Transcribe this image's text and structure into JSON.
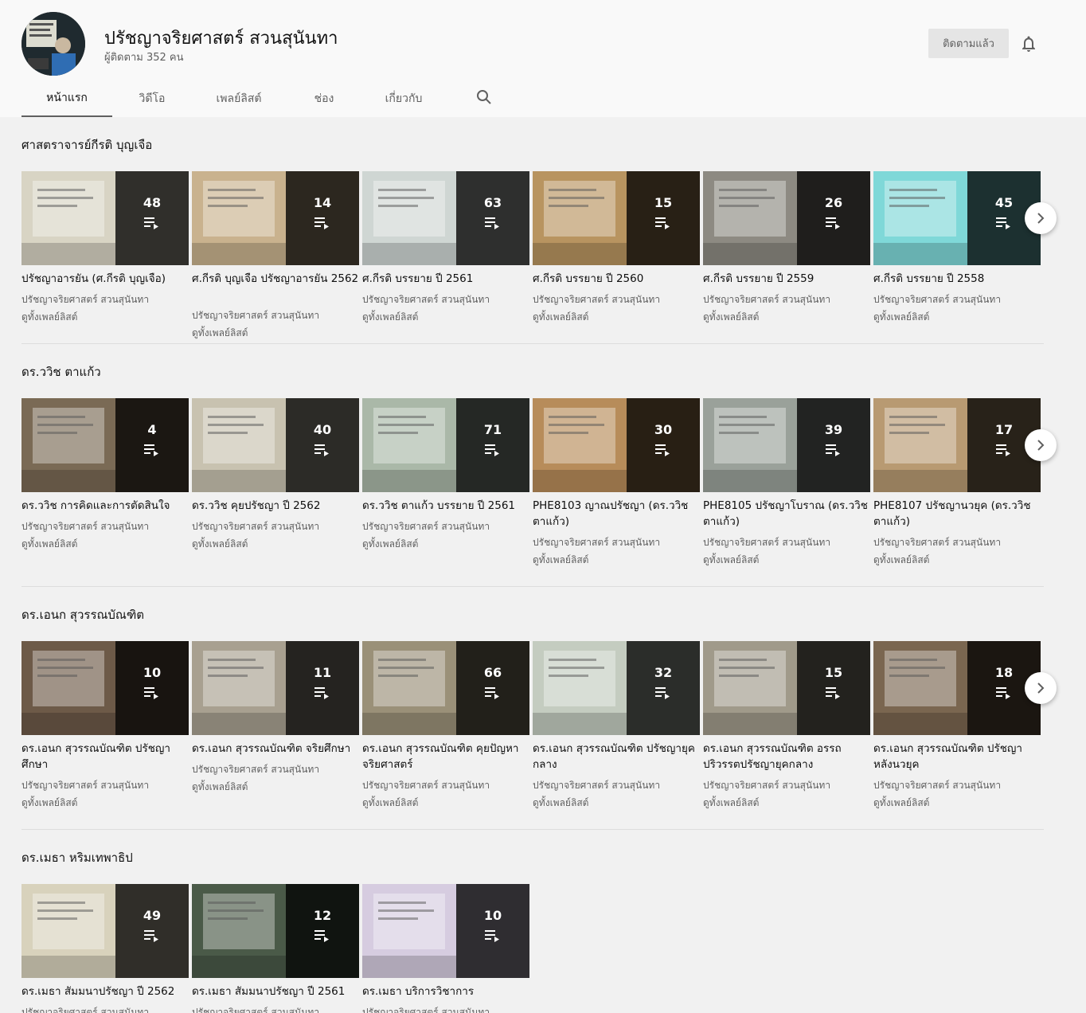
{
  "header": {
    "channel_title": "ปรัชญาจริยศาสตร์ สวนสุนันทา",
    "subscribers": "ผู้ติดตาม 352 คน",
    "subscribe_label": "ติดตามแล้ว"
  },
  "tabs": [
    {
      "label": "หน้าแรก",
      "active": true
    },
    {
      "label": "วิดีโอ"
    },
    {
      "label": "เพลย์ลิสต์"
    },
    {
      "label": "ช่อง"
    },
    {
      "label": "เกี่ยวกับ"
    }
  ],
  "sections": [
    {
      "title": "ศาสตราจารย์กีรติ บุญเจือ",
      "playlists": [
        {
          "title": "ปรัชญาอารยัน (ศ.กีรติ บุญเจือ)",
          "count": "48",
          "channel": "ปรัชญาจริยศาสตร์ สวนสุนันทา",
          "view_all": "ดูทั้งเพลย์ลิสต์",
          "thumb_color": "#d8d4c4"
        },
        {
          "title": "ศ.กีรติ บุญเจือ ปรัชญาอารยัน 2562",
          "count": "14",
          "channel": "ปรัชญาจริยศาสตร์ สวนสุนันทา",
          "view_all": "ดูทั้งเพลย์ลิสต์",
          "thumb_color": "#c9b28e"
        },
        {
          "title": "ศ.กีรติ บรรยาย ปี 2561",
          "count": "63",
          "channel": "ปรัชญาจริยศาสตร์ สวนสุนันทา",
          "view_all": "ดูทั้งเพลย์ลิสต์",
          "thumb_color": "#cfd6d3"
        },
        {
          "title": "ศ.กีรติ บรรยาย ปี 2560",
          "count": "15",
          "channel": "ปรัชญาจริยศาสตร์ สวนสุนันทา",
          "view_all": "ดูทั้งเพลย์ลิสต์",
          "thumb_color": "#b89460"
        },
        {
          "title": "ศ.กีรติ บรรยาย ปี 2559",
          "count": "26",
          "channel": "ปรัชญาจริยศาสตร์ สวนสุนันทา",
          "view_all": "ดูทั้งเพลย์ลิสต์",
          "thumb_color": "#8d8a82"
        },
        {
          "title": "ศ.กีรติ บรรยาย ปี 2558",
          "count": "45",
          "channel": "ปรัชญาจริยศาสตร์ สวนสุนันทา",
          "view_all": "ดูทั้งเพลย์ลิสต์",
          "thumb_color": "#7fd8d8"
        }
      ]
    },
    {
      "title": "ดร.ววิช ตาแก้ว",
      "playlists": [
        {
          "title": "ดร.ววิช การคิดและการตัดสินใจ",
          "count": "4",
          "channel": "ปรัชญาจริยศาสตร์ สวนสุนันทา",
          "view_all": "ดูทั้งเพลย์ลิสต์",
          "thumb_color": "#7a6a55"
        },
        {
          "title": "ดร.ววิช คุยปรัชญา ปี 2562",
          "count": "40",
          "channel": "ปรัชญาจริยศาสตร์ สวนสุนันทา",
          "view_all": "ดูทั้งเพลย์ลิสต์",
          "thumb_color": "#c8c2b0"
        },
        {
          "title": "ดร.ววิช ตาแก้ว บรรยาย ปี 2561",
          "count": "71",
          "channel": "ปรัชญาจริยศาสตร์ สวนสุนันทา",
          "view_all": "ดูทั้งเพลย์ลิสต์",
          "thumb_color": "#aab8a8"
        },
        {
          "title": "PHE8103 ญาณปรัชญา (ดร.ววิช ตาแก้ว)",
          "count": "30",
          "channel": "ปรัชญาจริยศาสตร์ สวนสุนันทา",
          "view_all": "ดูทั้งเพลย์ลิสต์",
          "thumb_color": "#b78c5a"
        },
        {
          "title": "PHE8105 ปรัชญาโบราณ (ดร.ววิช ตาแก้ว)",
          "count": "39",
          "channel": "ปรัชญาจริยศาสตร์ สวนสุนันทา",
          "view_all": "ดูทั้งเพลย์ลิสต์",
          "thumb_color": "#9aa19a"
        },
        {
          "title": "PHE8107 ปรัชญานวยุค (ดร.ววิช ตาแก้ว)",
          "count": "17",
          "channel": "ปรัชญาจริยศาสตร์ สวนสุนันทา",
          "view_all": "ดูทั้งเพลย์ลิสต์",
          "thumb_color": "#b89a72"
        }
      ]
    },
    {
      "title": "ดร.เอนก สุวรรณบัณฑิต",
      "playlists": [
        {
          "title": "ดร.เอนก สุวรรณบัณฑิต ปรัชญาศึกษา",
          "count": "10",
          "channel": "ปรัชญาจริยศาสตร์ สวนสุนันทา",
          "view_all": "ดูทั้งเพลย์ลิสต์",
          "thumb_color": "#6d5a48"
        },
        {
          "title": "ดร.เอนก สุวรรณบัณฑิต จริยศึกษา",
          "count": "11",
          "channel": "ปรัชญาจริยศาสตร์ สวนสุนันทา",
          "view_all": "ดูทั้งเพลย์ลิสต์",
          "thumb_color": "#a8a090"
        },
        {
          "title": "ดร.เอนก สุวรรณบัณฑิต คุยปัญหาจริยศาสตร์",
          "count": "66",
          "channel": "ปรัชญาจริยศาสตร์ สวนสุนันทา",
          "view_all": "ดูทั้งเพลย์ลิสต์",
          "thumb_color": "#9a9078"
        },
        {
          "title": "ดร.เอนก สุวรรณบัณฑิต ปรัชญายุคกลาง",
          "count": "32",
          "channel": "ปรัชญาจริยศาสตร์ สวนสุนันทา",
          "view_all": "ดูทั้งเพลย์ลิสต์",
          "thumb_color": "#c4ccc0"
        },
        {
          "title": "ดร.เอนก สุวรรณบัณฑิต อรรถปริวรรตปรัชญายุคกลาง",
          "count": "15",
          "channel": "ปรัชญาจริยศาสตร์ สวนสุนันทา",
          "view_all": "ดูทั้งเพลย์ลิสต์",
          "thumb_color": "#a09a8a"
        },
        {
          "title": "ดร.เอนก สุวรรณบัณฑิต ปรัชญาหลังนวยุค",
          "count": "18",
          "channel": "ปรัชญาจริยศาสตร์ สวนสุนันทา",
          "view_all": "ดูทั้งเพลย์ลิสต์",
          "thumb_color": "#7a6650"
        }
      ]
    },
    {
      "title": "ดร.เมธา หริมเทพาธิป",
      "playlists": [
        {
          "title": "ดร.เมธา สัมมนาปรัชญา ปี 2562",
          "count": "49",
          "channel": "ปรัชญาจริยศาสตร์ สวนสุนันทา",
          "view_all": "ดูทั้งเพลย์ลิสต์",
          "thumb_color": "#d8d2bc"
        },
        {
          "title": "ดร.เมธา สัมมนาปรัชญา ปี 2561",
          "count": "12",
          "channel": "ปรัชญาจริยศาสตร์ สวนสุนันทา",
          "view_all": "ดูทั้งเพลย์ลิสต์",
          "thumb_color": "#4a5a48"
        },
        {
          "title": "ดร.เมธา บริการวิชาการ",
          "count": "10",
          "channel": "ปรัชญาจริยศาสตร์ สวนสุนันทา",
          "view_all": "ดูทั้งเพลย์ลิสต์",
          "thumb_color": "#d6cce0"
        }
      ]
    }
  ]
}
